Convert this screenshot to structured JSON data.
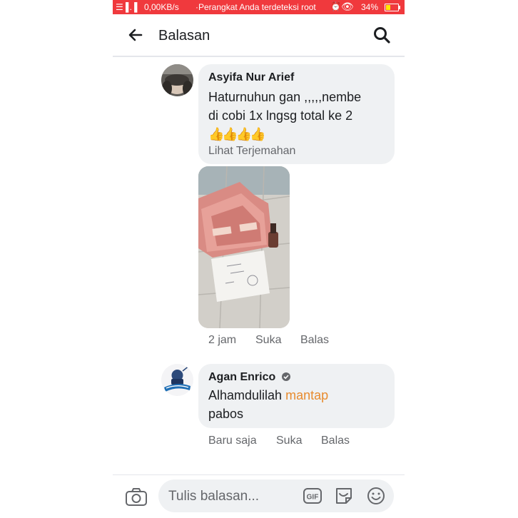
{
  "status_bar": {
    "signal": "☰▐ .▐",
    "network_speed": "0,00KB/s",
    "notification": "·Perangkat Anda terdeteksi root",
    "battery_percent": "34%"
  },
  "header": {
    "title": "Balasan",
    "back_icon": "arrow-left-icon",
    "search_icon": "search-icon"
  },
  "comments": [
    {
      "author": "Asyifa Nur Arief",
      "line1": "Haturnuhun gan ,,,,,nembe",
      "line2": "di cobi 1x lngsg total ke 2",
      "emoji": "👍👍👍👍",
      "translate_label": "Lihat Terjemahan",
      "time": "2 jam",
      "like_label": "Suka",
      "reply_label": "Balas"
    },
    {
      "author": "Agan Enrico",
      "text_plain": "Alhamdulilah",
      "text_link": "mantap",
      "text_line2": "pabos",
      "link_color": "#e88b2e",
      "time": "Baru saja",
      "like_label": "Suka",
      "reply_label": "Balas"
    }
  ],
  "composer": {
    "placeholder": "Tulis balasan...",
    "camera_icon": "camera-icon",
    "gif_icon": "gif-icon",
    "sticker_icon": "sticker-icon",
    "emoji_icon": "smiley-icon"
  },
  "colors": {
    "status_bar": "#f0393d",
    "bubble": "#eff1f3",
    "secondary_text": "#65676b"
  }
}
